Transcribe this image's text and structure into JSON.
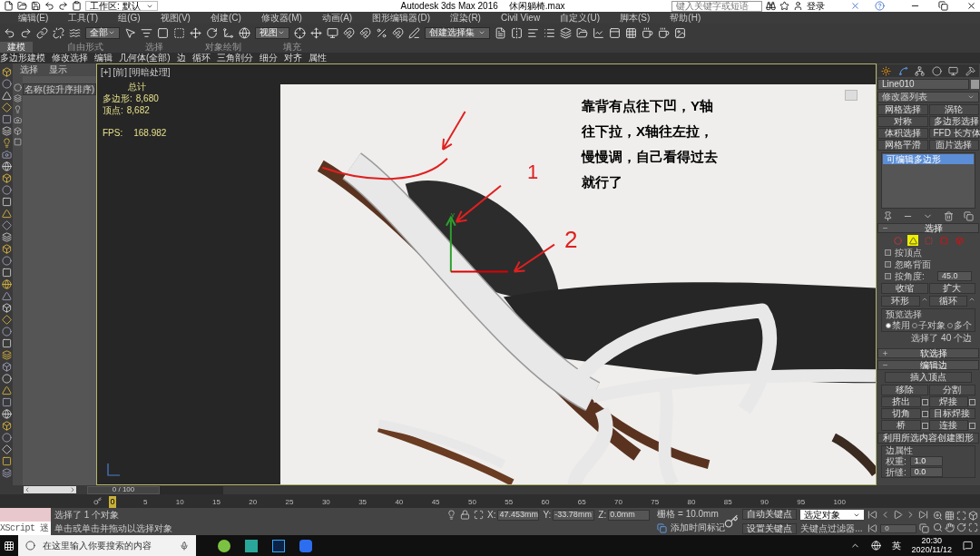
{
  "title_bar": {
    "workspace": "工作区: 默认",
    "app": "Autodesk 3ds Max 2016",
    "file": "休闲躺椅.max",
    "search": {
      "placeholder": "键入关键字或短语"
    },
    "login": "登录"
  },
  "menu": [
    "编辑(E)",
    "工具(T)",
    "组(G)",
    "视图(V)",
    "创建(C)",
    "修改器(M)",
    "动画(A)",
    "图形编辑器(D)",
    "渲染(R)",
    "Civil View",
    "自定义(U)",
    "脚本(S)",
    "帮助(H)"
  ],
  "toolbar": {
    "selection_filter": "全部",
    "reference_coord": "视图",
    "selection_set": "创建选择集"
  },
  "ribbon": {
    "tabs": [
      {
        "label": "建模",
        "selected": true
      },
      {
        "label": "自由形式",
        "selected": false
      },
      {
        "label": "选择",
        "selected": false
      },
      {
        "label": "对象绘制",
        "selected": false
      },
      {
        "label": "填充",
        "selected": false
      }
    ],
    "panels": [
      "多边形建模",
      "修改选择",
      "编辑",
      "几何体(全部)",
      "边",
      "循环",
      "三角剖分",
      "细分",
      "对齐",
      "属性"
    ]
  },
  "scene_explorer": {
    "tabs": [
      "选择",
      "显示"
    ],
    "column": "名称(按升序排序)"
  },
  "viewport": {
    "labels": [
      "[+]",
      "[前]",
      "[明暗处理]"
    ],
    "stats_title": "总计",
    "stats": [
      {
        "label": "多边形:",
        "value": "8,680"
      },
      {
        "label": "顶点:",
        "value": "8,682"
      }
    ],
    "fps": {
      "label": "FPS:",
      "value": "168.982"
    },
    "annotation": "靠背有点往下凹，Y轴往下拉，X轴往左拉，慢慢调，自己看得过去就行了",
    "marks": [
      "1",
      "2"
    ],
    "gizmo_label": "y"
  },
  "command_panel": {
    "object_name": "Line010",
    "modifier_list": "修改器列表",
    "modifier_buttons": [
      "网格选择",
      "涡轮",
      "对称",
      "多边形选择",
      "体积选择",
      "FFD 长方体",
      "网格平滑",
      "面片选择"
    ],
    "stack": [
      {
        "label": "可编辑多边形",
        "selected": true
      }
    ],
    "selection": {
      "title": "选择",
      "expanded": true,
      "subobjects": [
        {
          "kind": "vertex",
          "selected": false
        },
        {
          "kind": "edge",
          "selected": true
        },
        {
          "kind": "border",
          "selected": false
        },
        {
          "kind": "polygon",
          "selected": false
        },
        {
          "kind": "element",
          "selected": false
        }
      ],
      "options": [
        {
          "label": "按顶点",
          "checked": false
        },
        {
          "label": "忽略背面",
          "checked": false
        },
        {
          "label": "按角度:",
          "checked": false
        }
      ],
      "angle": "45.0",
      "buttons": [
        "收缩",
        "扩大"
      ],
      "spinner_buttons": [
        "环形",
        "循环"
      ],
      "preview": {
        "title": "预览选择",
        "options": [
          {
            "label": "禁用",
            "selected": true
          },
          {
            "label": "子对象",
            "selected": false
          },
          {
            "label": "多个",
            "selected": false
          }
        ]
      },
      "summary": "选择了 40 个边"
    },
    "soft_selection": {
      "title": "软选择",
      "expanded": false
    },
    "edit_edges": {
      "title": "编辑边",
      "expanded": true,
      "insert": "插入顶点",
      "buttons": [
        {
          "label": "移除",
          "settings": false
        },
        {
          "label": "分割",
          "settings": false
        },
        {
          "label": "挤出",
          "settings": true
        },
        {
          "label": "焊接",
          "settings": true
        },
        {
          "label": "切角",
          "settings": true
        },
        {
          "label": "目标焊接",
          "settings": false
        },
        {
          "label": "桥",
          "settings": true
        },
        {
          "label": "连接",
          "settings": true
        }
      ],
      "create_shape": "利用所选内容创建图形",
      "properties": {
        "title": "边属性",
        "fields": [
          {
            "label": "权重:",
            "value": "1.0"
          },
          {
            "label": "折缝:",
            "value": "0.0"
          }
        ]
      }
    }
  },
  "timeline": {
    "frame": "0 / 100",
    "level": 0,
    "thumb": "0",
    "ticks": [
      "5",
      "10",
      "15",
      "20",
      "25",
      "30",
      "35",
      "40",
      "45",
      "50",
      "55",
      "60",
      "65",
      "70",
      "75",
      "80",
      "85",
      "90",
      "95",
      "100"
    ]
  },
  "status": {
    "maxscript": "XScript 迷",
    "selected": "选择了 1 个对象",
    "prompt": "单击或单击并拖动以选择对象",
    "coords": [
      {
        "label": "X:",
        "value": "47.453mm"
      },
      {
        "label": "Y:",
        "value": "-33.78mm"
      },
      {
        "label": "Z:",
        "value": "0.0mm"
      }
    ],
    "grid": "栅格 = 10.0mm",
    "add_tag": "添加时间标记",
    "auto_key": "自动关键点",
    "key_mode": "选定对象",
    "set_key": "设置关键点",
    "key_filters": "关键点过滤器...",
    "frame": "0"
  },
  "taskbar": {
    "search": {
      "placeholder": "在这里输入你要搜索的内容"
    },
    "ime": "英",
    "time": "20:30",
    "date": "2020/11/12"
  }
}
